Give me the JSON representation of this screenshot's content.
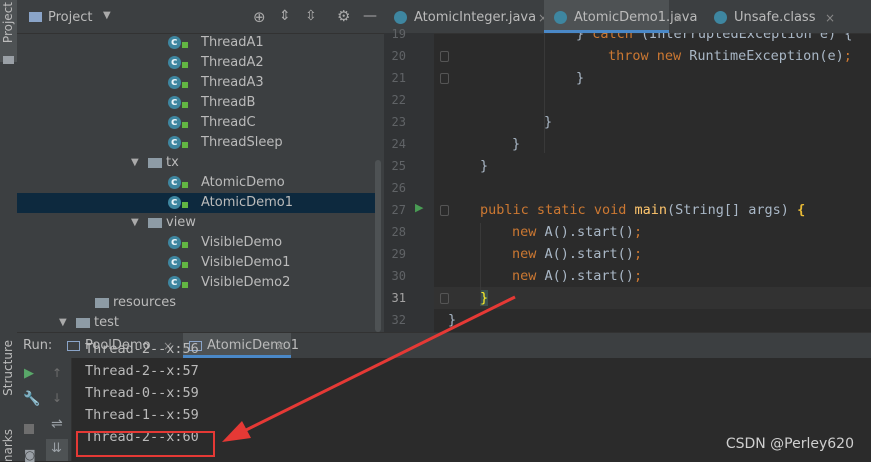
{
  "left_strip": {
    "project_label": "Project",
    "structure_label": "Structure",
    "bookmarks_label": "marks"
  },
  "project_panel": {
    "title": "Project",
    "tree": [
      {
        "label": "ThreadA1",
        "kind": "class",
        "indent": 1
      },
      {
        "label": "ThreadA2",
        "kind": "class",
        "indent": 1
      },
      {
        "label": "ThreadA3",
        "kind": "class",
        "indent": 1
      },
      {
        "label": "ThreadB",
        "kind": "class",
        "indent": 1
      },
      {
        "label": "ThreadC",
        "kind": "class",
        "indent": 1
      },
      {
        "label": "ThreadSleep",
        "kind": "class",
        "indent": 1
      },
      {
        "label": "tx",
        "kind": "folder",
        "indent": 0
      },
      {
        "label": "AtomicDemo",
        "kind": "class",
        "indent": 1
      },
      {
        "label": "AtomicDemo1",
        "kind": "class",
        "indent": 1,
        "selected": true
      },
      {
        "label": "view",
        "kind": "folder",
        "indent": 0
      },
      {
        "label": "VisibleDemo",
        "kind": "class",
        "indent": 1
      },
      {
        "label": "VisibleDemo1",
        "kind": "class",
        "indent": 1
      },
      {
        "label": "VisibleDemo2",
        "kind": "class",
        "indent": 1
      },
      {
        "label": "resources",
        "kind": "resfolder",
        "indent": -1
      },
      {
        "label": "test",
        "kind": "folder",
        "indent": -2
      }
    ]
  },
  "editor": {
    "tabs": [
      {
        "label": "AtomicInteger.java",
        "active": false
      },
      {
        "label": "AtomicDemo1.java",
        "active": true
      },
      {
        "label": "Unsafe.class",
        "active": false
      }
    ],
    "current_line": "31",
    "lines": [
      {
        "n": "19",
        "code": "} catch (InterruptedException e) {"
      },
      {
        "n": "20",
        "code": "throw new RuntimeException(e);"
      },
      {
        "n": "21",
        "code": "}"
      },
      {
        "n": "22",
        "code": ""
      },
      {
        "n": "23",
        "code": "}"
      },
      {
        "n": "24",
        "code": "}"
      },
      {
        "n": "25",
        "code": "}"
      },
      {
        "n": "26",
        "code": ""
      },
      {
        "n": "27",
        "code": "public static void main(String[] args) {"
      },
      {
        "n": "28",
        "code": "new A().start();"
      },
      {
        "n": "29",
        "code": "new A().start();"
      },
      {
        "n": "30",
        "code": "new A().start();"
      },
      {
        "n": "31",
        "code": "}"
      },
      {
        "n": "32",
        "code": "}"
      }
    ]
  },
  "run_panel": {
    "label": "Run:",
    "tabs": [
      {
        "label": "PoolDemo",
        "active": false
      },
      {
        "label": "AtomicDemo1",
        "active": true
      }
    ],
    "output": [
      "Thread-2--x:56",
      "Thread-2--x:57",
      "Thread-0--x:59",
      "Thread-1--x:59",
      "Thread-2--x:60"
    ]
  },
  "watermark": "CSDN @Perley620",
  "colors": {
    "highlight_box": "#e53935",
    "arrow": "#e53935",
    "accent": "#4a88c7"
  }
}
